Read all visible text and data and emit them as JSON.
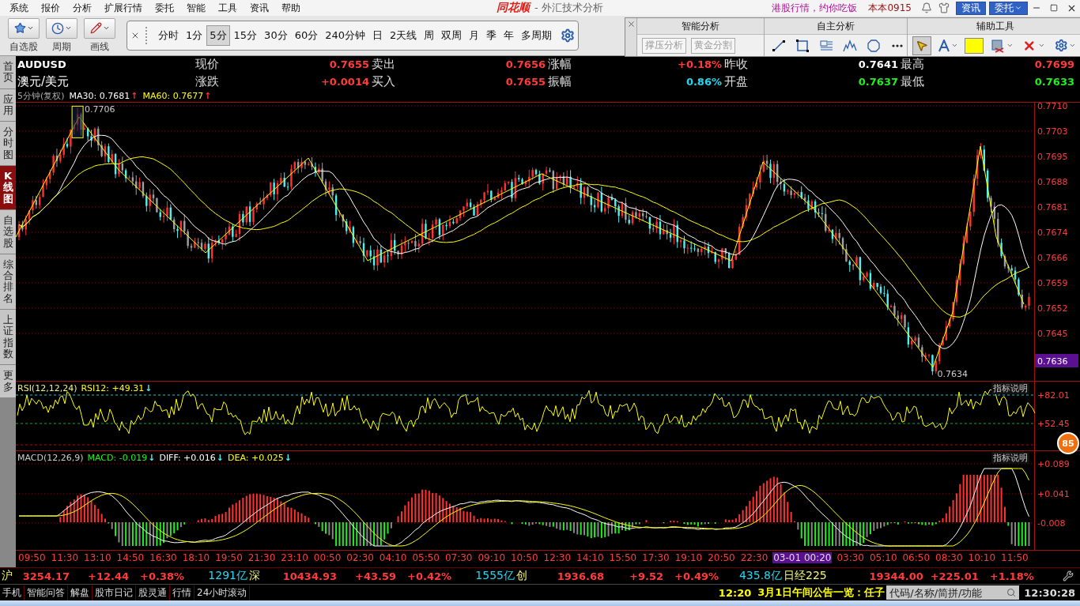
{
  "menu": [
    "系统",
    "报价",
    "分析",
    "扩展行情",
    "委托",
    "智能",
    "工具",
    "资讯",
    "帮助"
  ],
  "app": {
    "logo": "同花顺",
    "title": "- 外汇技术分析"
  },
  "top_right": {
    "promo": "港股行情，约你吃饭",
    "version": "本本0915",
    "buttons": [
      "资讯",
      "委托"
    ]
  },
  "big_tools": [
    {
      "kind": "star",
      "label": "自选股"
    },
    {
      "kind": "clock",
      "label": "周期"
    },
    {
      "kind": "pencil",
      "label": "画线"
    }
  ],
  "periods": [
    {
      "label": "分时",
      "selected": false
    },
    {
      "label": "1分",
      "selected": false
    },
    {
      "label": "5分",
      "selected": true
    },
    {
      "label": "15分",
      "selected": false
    },
    {
      "label": "30分",
      "selected": false
    },
    {
      "label": "60分",
      "selected": false
    },
    {
      "label": "240分钟",
      "selected": false
    },
    {
      "label": "日",
      "selected": false
    },
    {
      "label": "2天线",
      "selected": false
    },
    {
      "label": "周",
      "selected": false
    },
    {
      "label": "双周",
      "selected": false
    },
    {
      "label": "月",
      "selected": false
    },
    {
      "label": "季",
      "selected": false
    },
    {
      "label": "年",
      "selected": false
    },
    {
      "label": "多周期",
      "selected": false
    }
  ],
  "float_panel": {
    "sections": [
      "智能分析",
      "自主分析",
      "辅助工具"
    ],
    "buttons": [
      {
        "label": "撑压分析",
        "disabled": true
      },
      {
        "label": "黄金分割",
        "disabled": true
      }
    ],
    "tools": [
      {
        "kind": "line",
        "selected": false
      },
      {
        "kind": "rect",
        "selected": false
      },
      {
        "kind": "text",
        "selected": false
      },
      {
        "kind": "wave",
        "selected": false
      },
      {
        "kind": "circle",
        "selected": false
      },
      {
        "kind": "more",
        "selected": false
      },
      {
        "kind": "pointer",
        "selected": true
      },
      {
        "kind": "font",
        "selected": false
      },
      {
        "kind": "swatch",
        "selected": false,
        "color": "#ffff00"
      },
      {
        "kind": "erase",
        "selected": false
      },
      {
        "kind": "delete",
        "selected": false
      },
      {
        "kind": "settings",
        "selected": false
      }
    ]
  },
  "left_tabs": [
    {
      "label": "首页",
      "selected": false
    },
    {
      "label": "应用",
      "selected": false
    },
    {
      "label": "分时图",
      "selected": false
    },
    {
      "label": "K线图",
      "selected": true
    },
    {
      "label": "自选股",
      "selected": false
    },
    {
      "label": "综合排名",
      "selected": false
    },
    {
      "label": "上证指数",
      "selected": false
    },
    {
      "label": "更多",
      "selected": false
    }
  ],
  "quote": {
    "symbol": "AUDUSD",
    "name": "澳元/美元",
    "rows": [
      {
        "cells": [
          {
            "label": "现价",
            "value": "0.7655",
            "color": "#ff3b3b"
          },
          {
            "label": "卖出",
            "value": "0.7656",
            "color": "#ff3b3b"
          },
          {
            "label": "涨幅",
            "value": "+0.18%",
            "color": "#ff3b3b"
          },
          {
            "label": "昨收",
            "value": "0.7641",
            "color": "#ffffff"
          },
          {
            "label": "最高",
            "value": "0.7699",
            "color": "#ff3b3b"
          }
        ]
      },
      {
        "cells": [
          {
            "label": "涨跌",
            "value": "+0.0014",
            "color": "#ff3b3b"
          },
          {
            "label": "买入",
            "value": "0.7655",
            "color": "#ff3b3b"
          },
          {
            "label": "振幅",
            "value": "0.86%",
            "color": "#22d8f0"
          },
          {
            "label": "开盘",
            "value": "0.7637",
            "color": "#22ee22"
          },
          {
            "label": "最低",
            "value": "0.7633",
            "color": "#22ee22"
          }
        ]
      }
    ]
  },
  "chart": {
    "period": "5分钟(复权)",
    "ma": [
      {
        "label": "MA30: 0.7681",
        "color": "#ffffff",
        "arrow": "↑"
      },
      {
        "label": "MA60: 0.7677",
        "color": "#ffff00",
        "arrow": "↑"
      }
    ],
    "price_axis": [
      "0.7710",
      "0.7703",
      "0.7695",
      "0.7688",
      "0.7681",
      "0.7674",
      "0.7666",
      "0.7659",
      "0.7652",
      "0.7645"
    ],
    "current_price": "0.7636",
    "high_marker": "0.7706",
    "low_marker": "0.7634"
  },
  "rsi": {
    "title": "RSI(12,12,24)",
    "reading": "RSI12: +49.31",
    "arrow": "↓",
    "help": "指标说明",
    "axis": [
      "+82.01",
      "+52.45"
    ]
  },
  "macd": {
    "title": "MACD(12,26,9)",
    "readings": [
      {
        "label": "MACD: -0.019",
        "color": "#22ee22",
        "arrow": "↓"
      },
      {
        "label": "DIFF: +0.016",
        "color": "#ffffff",
        "arrow": "↓"
      },
      {
        "label": "DEA: +0.025",
        "color": "#ffff00",
        "arrow": "↓"
      }
    ],
    "help": "指标说明",
    "axis": [
      "+0.089",
      "+0.041",
      "-0.008"
    ]
  },
  "badge": "85",
  "time_axis": [
    {
      "label": "09:50",
      "selected": false
    },
    {
      "label": "11:30",
      "selected": false
    },
    {
      "label": "13:10",
      "selected": false
    },
    {
      "label": "14:50",
      "selected": false
    },
    {
      "label": "16:30",
      "selected": false
    },
    {
      "label": "18:10",
      "selected": false
    },
    {
      "label": "19:50",
      "selected": false
    },
    {
      "label": "21:30",
      "selected": false
    },
    {
      "label": "23:10",
      "selected": false
    },
    {
      "label": "00:50",
      "selected": false
    },
    {
      "label": "02:30",
      "selected": false
    },
    {
      "label": "04:10",
      "selected": false
    },
    {
      "label": "05:50",
      "selected": false
    },
    {
      "label": "07:30",
      "selected": false
    },
    {
      "label": "09:10",
      "selected": false
    },
    {
      "label": "10:50",
      "selected": false
    },
    {
      "label": "12:30",
      "selected": false
    },
    {
      "label": "14:10",
      "selected": false
    },
    {
      "label": "15:50",
      "selected": false
    },
    {
      "label": "17:30",
      "selected": false
    },
    {
      "label": "19:10",
      "selected": false
    },
    {
      "label": "20:50",
      "selected": false
    },
    {
      "label": "22:30",
      "selected": false
    },
    {
      "label": "03-01 00:20",
      "selected": true
    },
    {
      "label": "03:30",
      "selected": false
    },
    {
      "label": "05:10",
      "selected": false
    },
    {
      "label": "06:50",
      "selected": false
    },
    {
      "label": "08:30",
      "selected": false
    },
    {
      "label": "10:10",
      "selected": false
    },
    {
      "label": "11:50",
      "selected": false
    }
  ],
  "indices": [
    {
      "name": "沪",
      "value": "3254.17",
      "change": "+12.44",
      "pct": "+0.38%",
      "amount": "1291亿"
    },
    {
      "name": "深",
      "value": "10434.93",
      "change": "+43.59",
      "pct": "+0.42%",
      "amount": "1555亿"
    },
    {
      "name": "创",
      "value": "1936.68",
      "change": "+9.52",
      "pct": "+0.49%",
      "amount": "435.8亿"
    },
    {
      "name": "日经225",
      "value": "19344.00",
      "change": "+225.01",
      "pct": "+1.18%"
    }
  ],
  "bottom_tabs": [
    "手机",
    "智能问答",
    "解盘",
    "股市日记",
    "股灵通",
    "行情",
    "24小时滚动"
  ],
  "news": {
    "time": "12:20",
    "headline": "3月1日午间公告一览：任子"
  },
  "search": {
    "placeholder": "代码/名称/简拼/功能"
  },
  "clock": "12:30:28"
}
